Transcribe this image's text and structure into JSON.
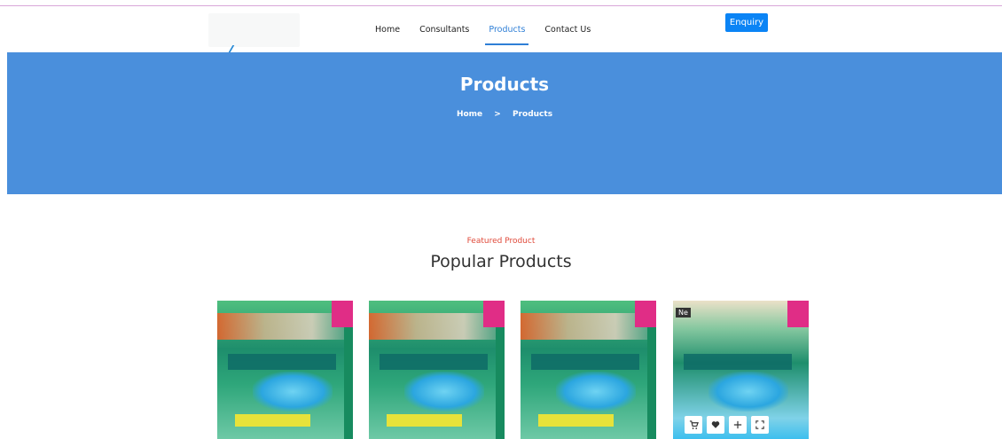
{
  "nav": {
    "items": [
      {
        "label": "Home",
        "active": false
      },
      {
        "label": "Consultants",
        "active": false
      },
      {
        "label": "Products",
        "active": true
      },
      {
        "label": "Contact Us",
        "active": false
      }
    ],
    "enquiry_label": "Enquiry"
  },
  "hero": {
    "title": "Products",
    "breadcrumb": {
      "home": "Home",
      "separator": ">",
      "current": "Products"
    }
  },
  "section": {
    "kicker": "Featured Product",
    "title": "Popular Products"
  },
  "products": [
    {
      "badge": ""
    },
    {
      "badge": ""
    },
    {
      "badge": ""
    },
    {
      "badge": "Ne",
      "hover_actions": [
        "cart-icon",
        "heart-icon",
        "plus-icon",
        "expand-icon"
      ]
    }
  ],
  "colors": {
    "accent": "#2f7fd6",
    "hero": "#4a8fdc",
    "button": "#0b84f5",
    "kicker": "#e04a3a"
  }
}
